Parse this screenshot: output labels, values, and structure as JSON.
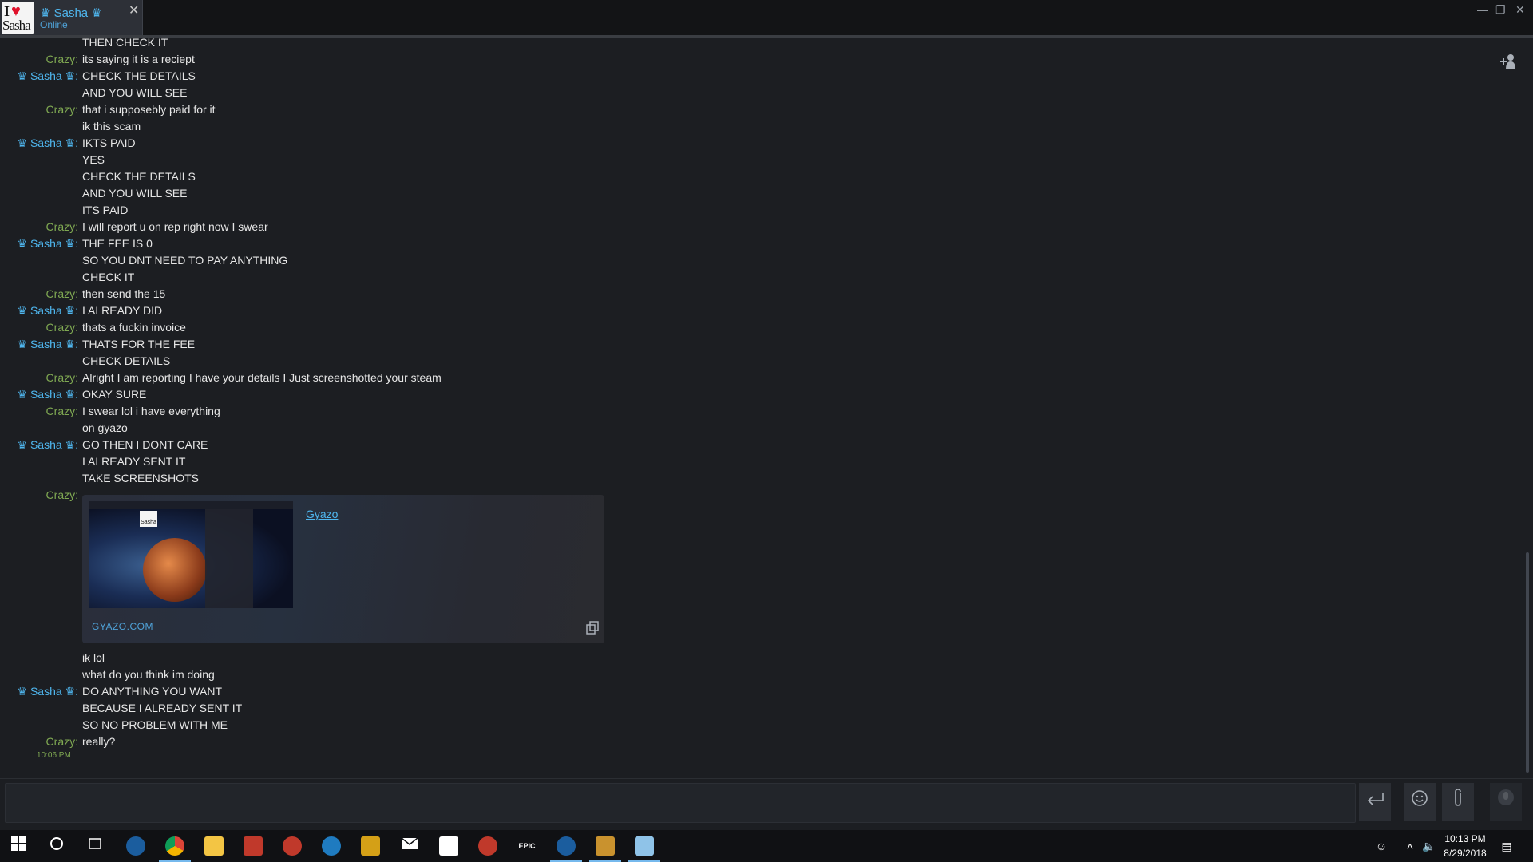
{
  "window": {
    "tab": {
      "name": "♛ Sasha ♛",
      "status": "Online",
      "avatar_text": "Sasha",
      "close": "✕"
    },
    "controls": {
      "minimize": "—",
      "maximize": "❐",
      "close": "✕"
    },
    "add_friend_icon": "add-friend"
  },
  "chat": {
    "messages": [
      {
        "sender": "",
        "text": "THEN CHECK IT"
      },
      {
        "sender": "Crazy:",
        "text": "its saying it is a reciept"
      },
      {
        "sender": "♛ Sasha ♛:",
        "text": "CHECK THE DETAILS"
      },
      {
        "sender": "",
        "text": "AND YOU WILL SEE"
      },
      {
        "sender": "Crazy:",
        "text": "that i supposebly paid for it"
      },
      {
        "sender": "",
        "text": "ik this scam"
      },
      {
        "sender": "♛ Sasha ♛:",
        "text": "IKTS PAID"
      },
      {
        "sender": "",
        "text": "YES"
      },
      {
        "sender": "",
        "text": "CHECK THE DETAILS"
      },
      {
        "sender": "",
        "text": "AND YOU WILL SEE"
      },
      {
        "sender": "",
        "text": "ITS PAID"
      },
      {
        "sender": "Crazy:",
        "text": "I will report u on rep right now I swear"
      },
      {
        "sender": "♛ Sasha ♛:",
        "text": "THE FEE IS 0"
      },
      {
        "sender": "",
        "text": "SO YOU DNT NEED TO PAY ANYTHING"
      },
      {
        "sender": "",
        "text": "CHECK IT"
      },
      {
        "sender": "Crazy:",
        "text": "then send the 15"
      },
      {
        "sender": "♛ Sasha ♛:",
        "text": "I ALREADY DID"
      },
      {
        "sender": "Crazy:",
        "text": "thats a fuckin invoice"
      },
      {
        "sender": "♛ Sasha ♛:",
        "text": "THATS FOR THE FEE"
      },
      {
        "sender": "",
        "text": "CHECK DETAILS"
      },
      {
        "sender": "Crazy:",
        "text": "Alright I am reporting I have your details I Just screenshotted your steam"
      },
      {
        "sender": "♛ Sasha ♛:",
        "text": "OKAY SURE"
      },
      {
        "sender": "Crazy:",
        "text": "I swear lol i have everything"
      },
      {
        "sender": "",
        "text": "on gyazo"
      },
      {
        "sender": "♛ Sasha ♛:",
        "text": "GO THEN I DONT CARE"
      },
      {
        "sender": "",
        "text": "I ALREADY SENT IT"
      },
      {
        "sender": "",
        "text": "TAKE SCREENSHOTS"
      },
      {
        "sender": "Crazy:",
        "text": ""
      }
    ],
    "embed": {
      "title": "Gyazo",
      "domain": "GYAZO.COM",
      "thumbnail_text": "Sasha"
    },
    "messages_after": [
      {
        "sender": "",
        "text": "ik lol"
      },
      {
        "sender": "",
        "text": "what do you think im doing"
      },
      {
        "sender": "♛ Sasha ♛:",
        "text": "DO ANYTHING YOU WANT"
      },
      {
        "sender": "",
        "text": "BECAUSE I ALREADY SENT IT"
      },
      {
        "sender": "",
        "text": "SO NO PROBLEM WITH ME"
      },
      {
        "sender": "Crazy:",
        "text": "really?"
      }
    ],
    "last_timestamp": "10:06 PM"
  },
  "input": {
    "placeholder": "",
    "send_icon": "send-arrow",
    "emoticon_icon": "emoticon",
    "attach_icon": "paperclip",
    "voice_icon": "microphone"
  },
  "taskbar": {
    "time": "10:13 PM",
    "date": "8/29/2018",
    "apps": [
      "start",
      "search",
      "task-view",
      "steam",
      "chrome",
      "file-explorer",
      "app-red",
      "app-radial",
      "app-ccleaner",
      "pubg",
      "mail",
      "video",
      "app-red-2",
      "epic-games",
      "steam-active",
      "cs-go",
      "notepad"
    ],
    "colors": {
      "accent": "#76b9ed",
      "sasha": "#4fb6ee",
      "crazy": "#7fa852"
    }
  }
}
